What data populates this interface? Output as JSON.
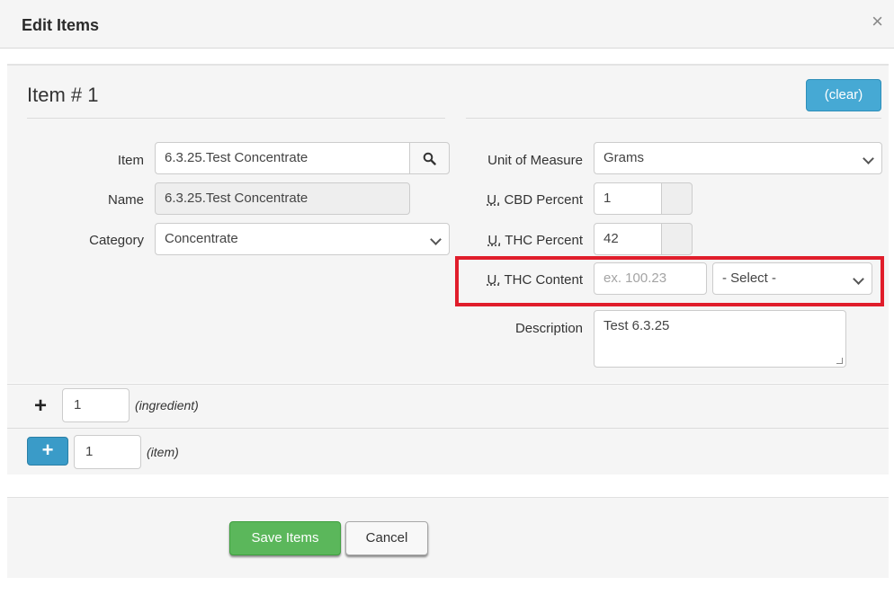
{
  "modal": {
    "title": "Edit Items",
    "close_symbol": "×"
  },
  "item_section": {
    "heading": "Item # 1",
    "clear_label": "(clear)",
    "left": {
      "item_label": "Item",
      "item_value": "6.3.25.Test Concentrate",
      "name_label": "Name",
      "name_value": "6.3.25.Test Concentrate",
      "category_label": "Category",
      "category_value": "Concentrate"
    },
    "right": {
      "uom_label": "Unit of Measure",
      "uom_value": "Grams",
      "u_abbr": "U.",
      "cbd_label": "CBD Percent",
      "cbd_value": "1",
      "thc_percent_label": "THC Percent",
      "thc_percent_value": "42",
      "thc_content_label": "THC Content",
      "thc_content_placeholder": "ex. 100.23",
      "thc_content_unit": "- Select -",
      "description_label": "Description",
      "description_value": "Test 6.3.25"
    }
  },
  "ingredient_row": {
    "plus_symbol": "+",
    "count": "1",
    "hint": "(ingredient)"
  },
  "item_row": {
    "plus_symbol": "+",
    "count": "1",
    "hint": "(item)"
  },
  "footer": {
    "save_label": "Save Items",
    "cancel_label": "Cancel"
  },
  "colors": {
    "save_green": "#5bb75b",
    "info_blue": "#46a9d4",
    "highlight_red": "#e01d2b"
  }
}
